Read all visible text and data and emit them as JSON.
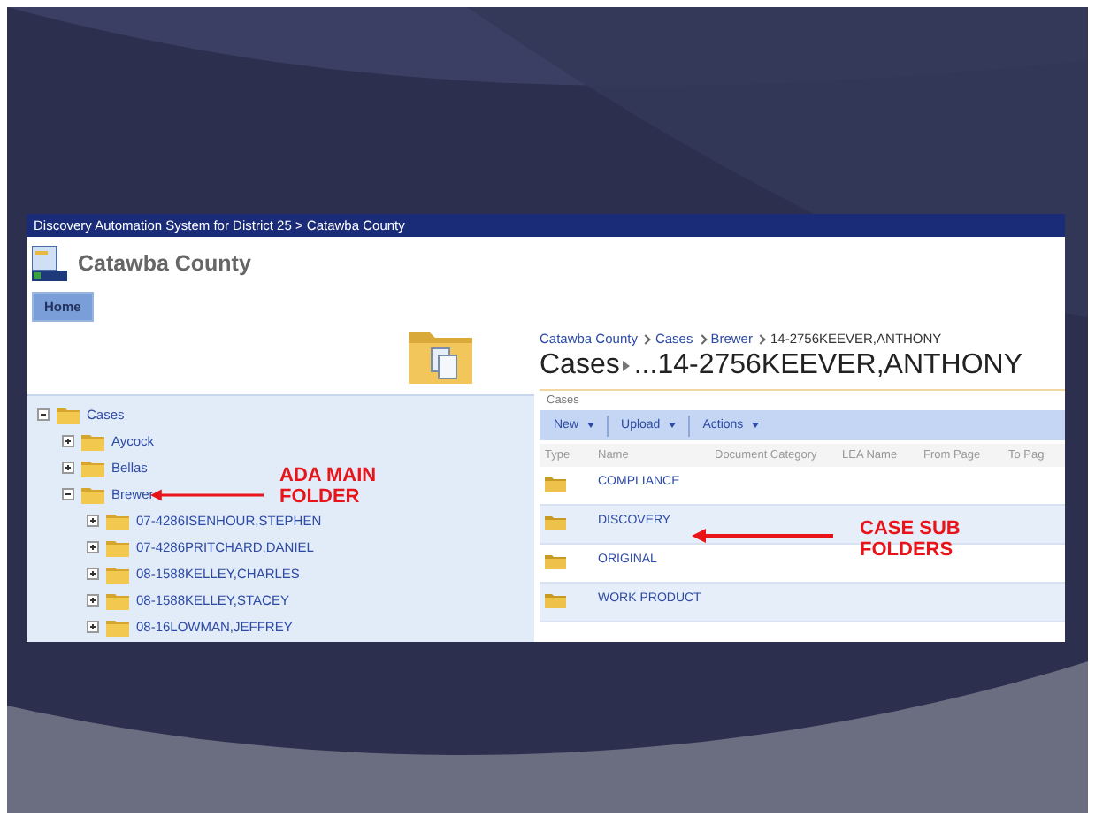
{
  "window": {
    "title": "Discovery Automation System for District 25 > Catawba County"
  },
  "site": {
    "name": "Catawba County",
    "tabs": [
      {
        "label": "Home",
        "selected": true
      }
    ]
  },
  "tree": [
    {
      "label": "Cases",
      "expanded": true,
      "children": [
        {
          "label": "Aycock",
          "expanded": false
        },
        {
          "label": "Bellas",
          "expanded": false
        },
        {
          "label": "Brewer",
          "expanded": true,
          "children": [
            {
              "label": "07-4286ISENHOUR,STEPHEN",
              "expanded": false
            },
            {
              "label": "07-4286PRITCHARD,DANIEL",
              "expanded": false
            },
            {
              "label": "08-1588KELLEY,CHARLES",
              "expanded": false
            },
            {
              "label": "08-1588KELLEY,STACEY",
              "expanded": false
            },
            {
              "label": "08-16LOWMAN,JEFFREY",
              "expanded": false
            }
          ]
        }
      ]
    }
  ],
  "breadcrumb": [
    "Catawba County",
    "Cases",
    "Brewer",
    "14-2756KEEVER,ANTHONY"
  ],
  "page_title": {
    "parent": "Cases",
    "current": "...14-2756KEEVER,ANTHONY"
  },
  "list_name": "Cases",
  "toolbar": [
    {
      "label": "New",
      "dropdown": true
    },
    {
      "label": "Upload",
      "dropdown": true
    },
    {
      "label": "Actions",
      "dropdown": true
    }
  ],
  "table": {
    "columns": [
      "Type",
      "Name",
      "Document Category",
      "LEA Name",
      "From Page",
      "To Pag"
    ],
    "rows": [
      {
        "name": "COMPLIANCE"
      },
      {
        "name": "DISCOVERY"
      },
      {
        "name": "ORIGINAL"
      },
      {
        "name": "WORK PRODUCT"
      }
    ]
  },
  "annotations": [
    {
      "lines": [
        "ADA MAIN",
        "FOLDER"
      ]
    },
    {
      "lines": [
        "CASE SUB",
        "FOLDERS"
      ]
    }
  ]
}
